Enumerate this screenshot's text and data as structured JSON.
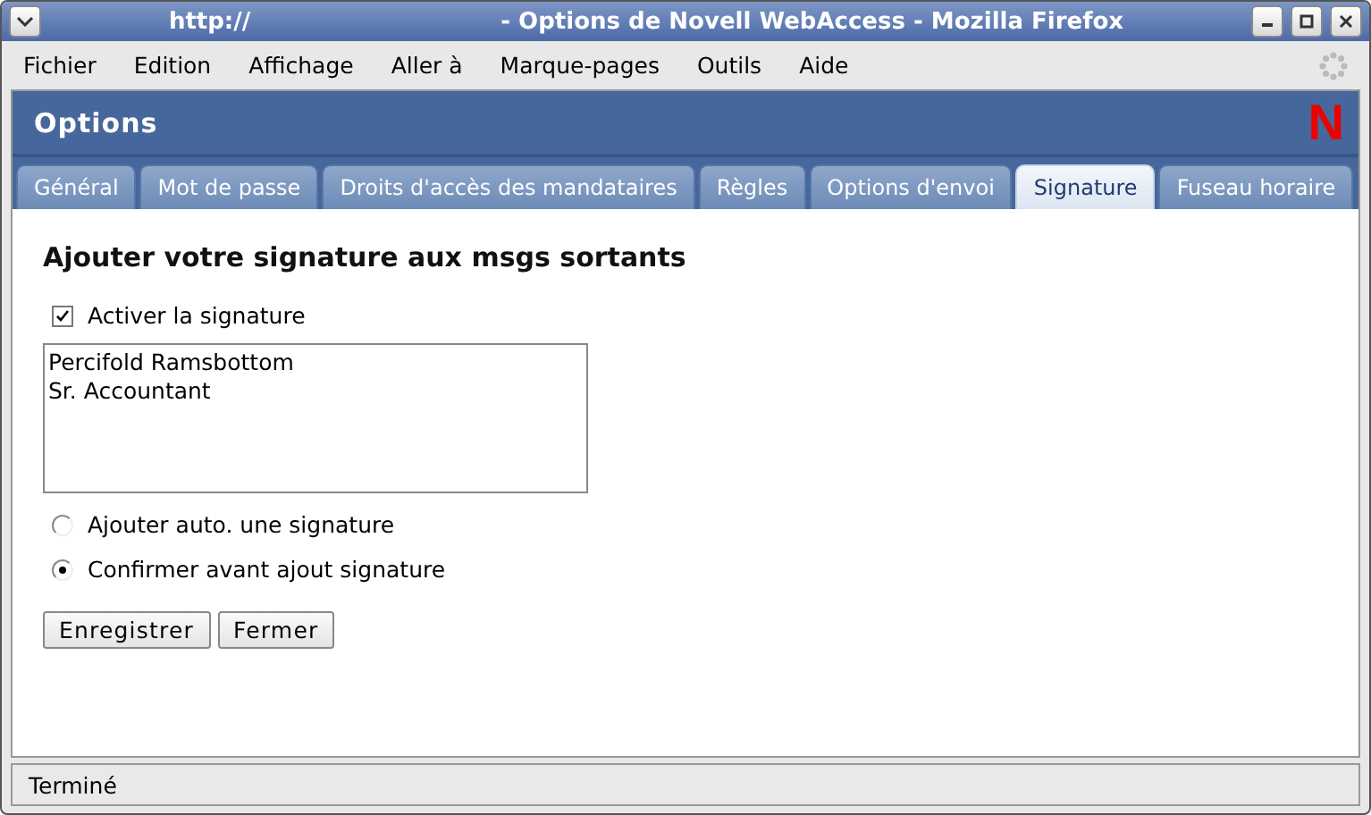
{
  "window": {
    "title_url": "http://",
    "title": "- Options de Novell WebAccess - Mozilla Firefox"
  },
  "menu": [
    "Fichier",
    "Edition",
    "Affichage",
    "Aller à",
    "Marque-pages",
    "Outils",
    "Aide"
  ],
  "header": {
    "title": "Options",
    "logo": "N"
  },
  "tabs": [
    {
      "label": "Général",
      "selected": false
    },
    {
      "label": "Mot de passe",
      "selected": false
    },
    {
      "label": "Droits d'accès des mandataires",
      "selected": false
    },
    {
      "label": "Règles",
      "selected": false
    },
    {
      "label": "Options d'envoi",
      "selected": false
    },
    {
      "label": "Signature",
      "selected": true
    },
    {
      "label": "Fuseau horaire",
      "selected": false
    }
  ],
  "heading": "Ajouter votre signature aux msgs sortants",
  "enable": {
    "label": "Activer la signature",
    "checked": true
  },
  "signature_lines": [
    "Percifold Ramsbottom",
    "Sr. Accountant"
  ],
  "options": [
    {
      "label": "Ajouter auto. une signature",
      "selected": false
    },
    {
      "label": "Confirmer avant ajout signature",
      "selected": true
    }
  ],
  "buttons": [
    "Enregistrer",
    "Fermer"
  ],
  "status_bar": "Terminé"
}
